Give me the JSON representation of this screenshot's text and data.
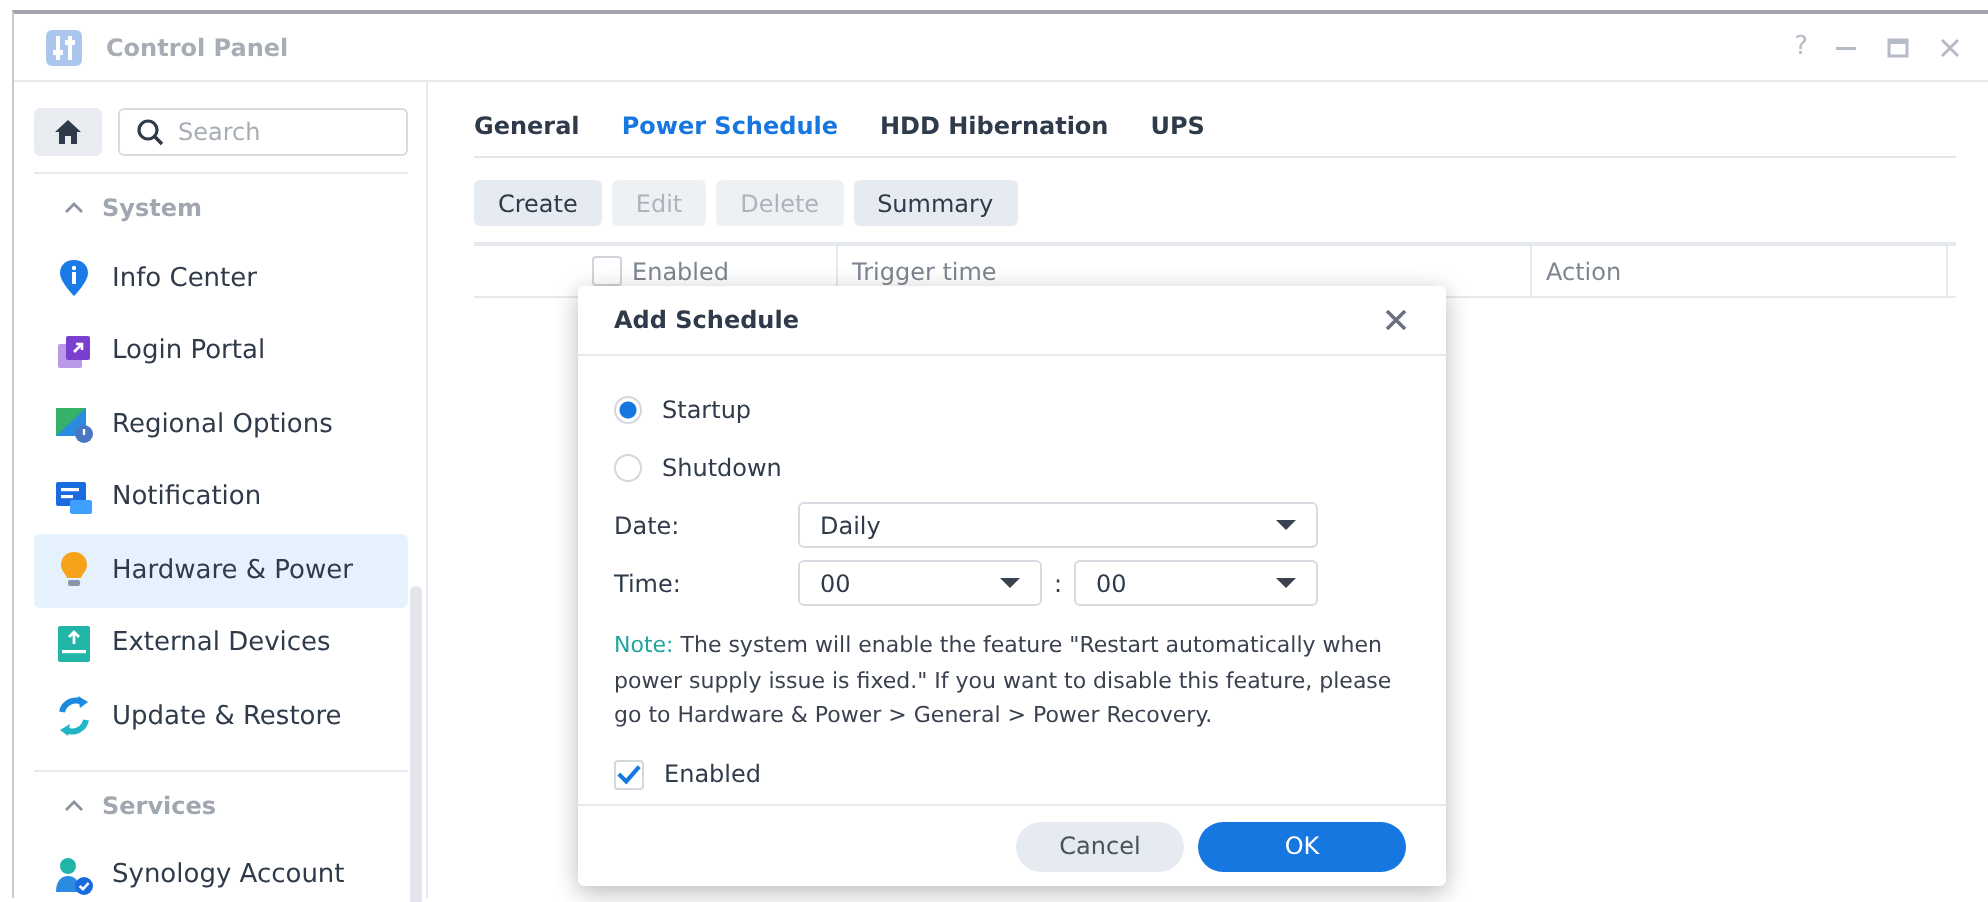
{
  "window": {
    "title": "Control Panel",
    "controls": [
      "?"
    ]
  },
  "sidebar": {
    "search": {
      "placeholder": "Search"
    },
    "groups": [
      {
        "label": "System",
        "expanded": true,
        "items": [
          {
            "label": "Info Center",
            "kind": "info",
            "selected": false
          },
          {
            "label": "Login Portal",
            "kind": "portal",
            "selected": false
          },
          {
            "label": "Regional Options",
            "kind": "regional",
            "selected": false
          },
          {
            "label": "Notification",
            "kind": "notification",
            "selected": false
          },
          {
            "label": "Hardware & Power",
            "kind": "bulb",
            "selected": true
          },
          {
            "label": "External Devices",
            "kind": "external",
            "selected": false
          },
          {
            "label": "Update & Restore",
            "kind": "update",
            "selected": false
          }
        ]
      },
      {
        "label": "Services",
        "expanded": true,
        "items": [
          {
            "label": "Synology Account",
            "kind": "account",
            "selected": false
          }
        ]
      }
    ]
  },
  "tabs": [
    {
      "label": "General",
      "selected": false
    },
    {
      "label": "Power Schedule",
      "selected": true
    },
    {
      "label": "HDD Hibernation",
      "selected": false
    },
    {
      "label": "UPS",
      "selected": false
    }
  ],
  "toolbar": [
    {
      "label": "Create",
      "disabled": false
    },
    {
      "label": "Edit",
      "disabled": true
    },
    {
      "label": "Delete",
      "disabled": true
    },
    {
      "label": "Summary",
      "disabled": false
    }
  ],
  "table": {
    "select_all": {
      "checked": false
    },
    "columns": [
      "Enabled",
      "Trigger time",
      "Action"
    ]
  },
  "dialog": {
    "title": "Add Schedule",
    "options": [
      {
        "label": "Startup",
        "selected": true
      },
      {
        "label": "Shutdown",
        "selected": false
      }
    ],
    "date": {
      "label": "Date:",
      "value": "Daily"
    },
    "time": {
      "label": "Time:",
      "hour": "00",
      "separator": ":",
      "minute": "00"
    },
    "note_label": "Note:",
    "note_text": "The system will enable the feature \"Restart automatically when power supply issue is fixed.\"  If you want to disable this feature, please go to Hardware & Power > General > Power Recovery.",
    "enabled": {
      "label": "Enabled",
      "checked": true
    },
    "buttons": [
      {
        "label": "Cancel",
        "kind": "secondary"
      },
      {
        "label": "OK",
        "kind": "primary"
      }
    ]
  }
}
